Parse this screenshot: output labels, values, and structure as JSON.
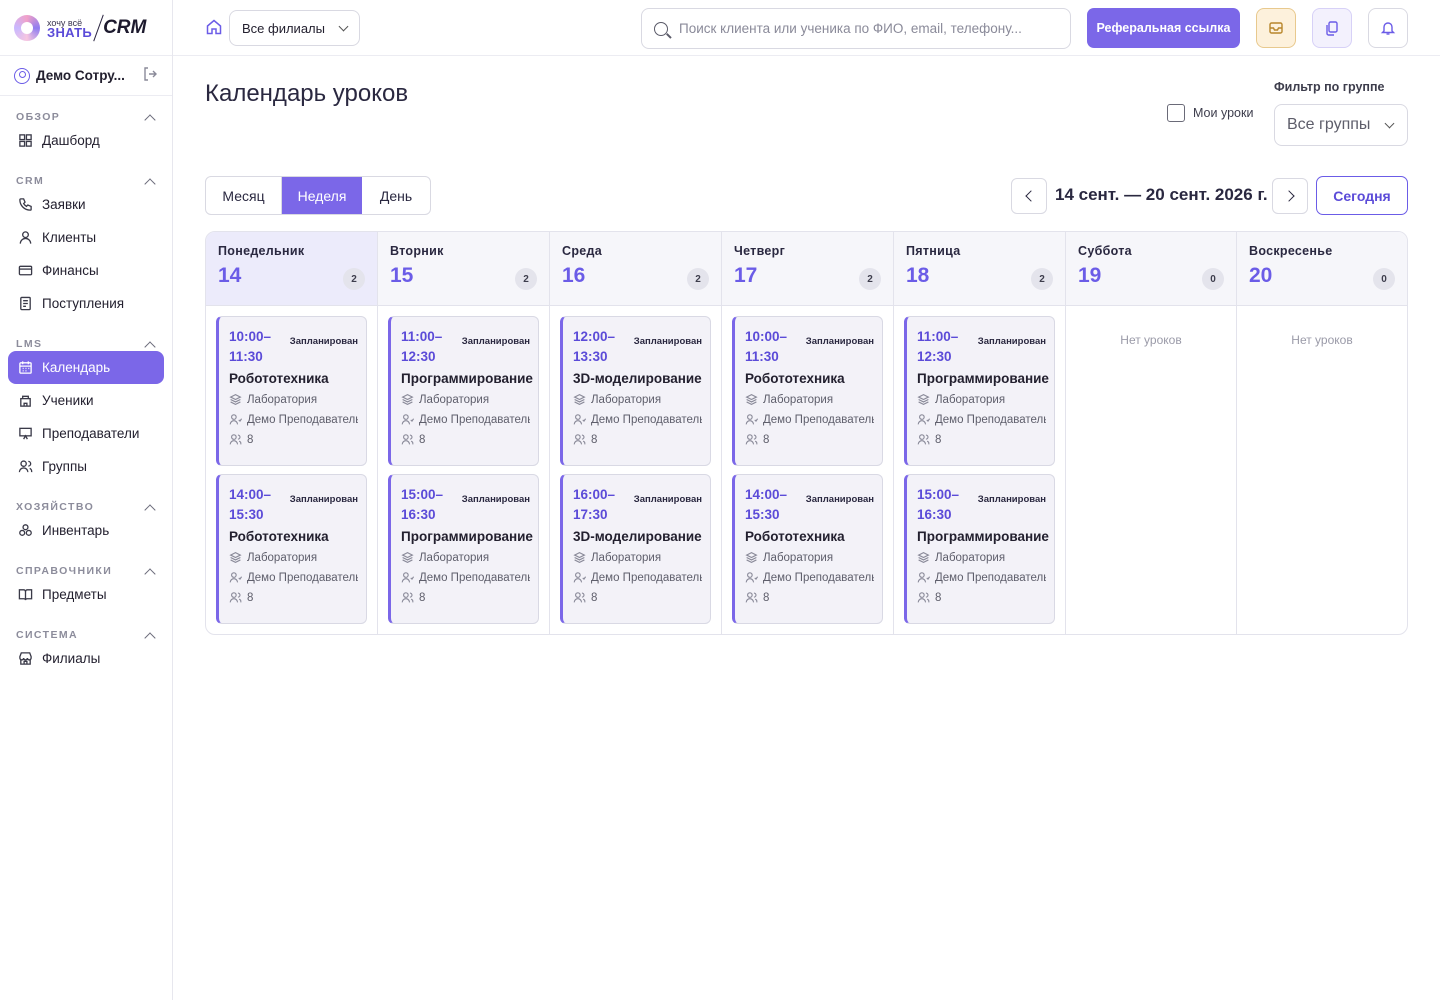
{
  "app": {
    "logo_small": "хочу всё",
    "logo_big": "ЗНАТЬ",
    "logo_crm": "CRM"
  },
  "user": {
    "name": "Демо Сотру..."
  },
  "sidebar": {
    "sections": [
      {
        "title": "ОБЗОР",
        "items": [
          {
            "label": "Дашборд",
            "icon": "dashboard-icon"
          }
        ]
      },
      {
        "title": "CRM",
        "items": [
          {
            "label": "Заявки",
            "icon": "phone-icon"
          },
          {
            "label": "Клиенты",
            "icon": "user-icon"
          },
          {
            "label": "Финансы",
            "icon": "card-icon"
          },
          {
            "label": "Поступления",
            "icon": "receipt-icon"
          }
        ]
      },
      {
        "title": "LMS",
        "items": [
          {
            "label": "Календарь",
            "icon": "calendar-icon",
            "active": true
          },
          {
            "label": "Ученики",
            "icon": "students-icon"
          },
          {
            "label": "Преподаватели",
            "icon": "teacher-icon"
          },
          {
            "label": "Группы",
            "icon": "group-icon"
          }
        ]
      },
      {
        "title": "ХОЗЯЙСТВО",
        "items": [
          {
            "label": "Инвентарь",
            "icon": "inventory-icon"
          }
        ]
      },
      {
        "title": "СПРАВОЧНИКИ",
        "items": [
          {
            "label": "Предметы",
            "icon": "book-icon"
          }
        ]
      },
      {
        "title": "СИСТЕМА",
        "items": [
          {
            "label": "Филиалы",
            "icon": "branch-icon"
          }
        ]
      }
    ]
  },
  "topbar": {
    "branch_select": "Все филиалы",
    "search_placeholder": "Поиск клиента или ученика по ФИО, email, телефону...",
    "referral_button": "Реферальная ссылка"
  },
  "page": {
    "title": "Календарь уроков",
    "my_lessons_label": "Мои уроки",
    "my_lessons_checked": false,
    "filter_label": "Фильтр по группе",
    "group_select": "Все группы",
    "views": {
      "month": "Месяц",
      "week": "Неделя",
      "day": "День",
      "active": "Неделя"
    },
    "range": "14 сент. — 20 сент. 2026 г.",
    "today_button": "Сегодня",
    "empty_text": "Нет уроков"
  },
  "colors": {
    "accent": "#7b67e8",
    "accent_dark": "#5b4bd8"
  },
  "days": [
    {
      "name": "Понедельник",
      "num": "14",
      "count": "2",
      "today": true,
      "lessons": [
        {
          "time": "10:00–\n11:30",
          "status": "Запланирован",
          "subject": "Робототехника",
          "room": "Лаборатория",
          "teacher": "Демо Преподаватель",
          "students": "8"
        },
        {
          "time": "14:00–\n15:30",
          "status": "Запланирован",
          "subject": "Робототехника",
          "room": "Лаборатория",
          "teacher": "Демо Преподаватель",
          "students": "8"
        }
      ]
    },
    {
      "name": "Вторник",
      "num": "15",
      "count": "2",
      "lessons": [
        {
          "time": "11:00–\n12:30",
          "status": "Запланирован",
          "subject": "Программирование",
          "room": "Лаборатория",
          "teacher": "Демо Преподаватель",
          "students": "8"
        },
        {
          "time": "15:00–\n16:30",
          "status": "Запланирован",
          "subject": "Программирование",
          "room": "Лаборатория",
          "teacher": "Демо Преподаватель",
          "students": "8"
        }
      ]
    },
    {
      "name": "Среда",
      "num": "16",
      "count": "2",
      "lessons": [
        {
          "time": "12:00–\n13:30",
          "status": "Запланирован",
          "subject": "3D-моделирование",
          "room": "Лаборатория",
          "teacher": "Демо Преподаватель",
          "students": "8"
        },
        {
          "time": "16:00–\n17:30",
          "status": "Запланирован",
          "subject": "3D-моделирование",
          "room": "Лаборатория",
          "teacher": "Демо Преподаватель",
          "students": "8"
        }
      ]
    },
    {
      "name": "Четверг",
      "num": "17",
      "count": "2",
      "lessons": [
        {
          "time": "10:00–\n11:30",
          "status": "Запланирован",
          "subject": "Робототехника",
          "room": "Лаборатория",
          "teacher": "Демо Преподаватель",
          "students": "8"
        },
        {
          "time": "14:00–\n15:30",
          "status": "Запланирован",
          "subject": "Робототехника",
          "room": "Лаборатория",
          "teacher": "Демо Преподаватель",
          "students": "8"
        }
      ]
    },
    {
      "name": "Пятница",
      "num": "18",
      "count": "2",
      "lessons": [
        {
          "time": "11:00–\n12:30",
          "status": "Запланирован",
          "subject": "Программирование",
          "room": "Лаборатория",
          "teacher": "Демо Преподаватель",
          "students": "8"
        },
        {
          "time": "15:00–\n16:30",
          "status": "Запланирован",
          "subject": "Программирование",
          "room": "Лаборатория",
          "teacher": "Демо Преподаватель",
          "students": "8"
        }
      ]
    },
    {
      "name": "Суббота",
      "num": "19",
      "count": "0",
      "lessons": []
    },
    {
      "name": "Воскресенье",
      "num": "20",
      "count": "0",
      "lessons": []
    }
  ]
}
